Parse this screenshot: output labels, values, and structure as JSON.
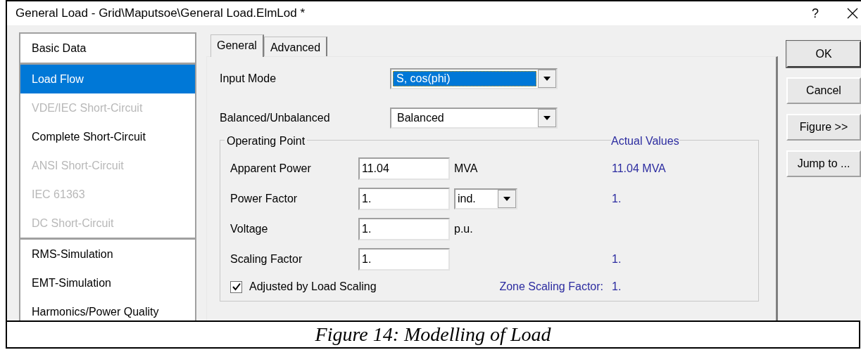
{
  "window": {
    "title": "General Load - Grid\\Maputsoe\\General Load.ElmLod *",
    "help": "?"
  },
  "sidebar": {
    "groups": [
      [
        {
          "label": "Basic Data",
          "selected": false,
          "disabled": false
        }
      ],
      [
        {
          "label": "Load Flow",
          "selected": true,
          "disabled": false
        },
        {
          "label": "VDE/IEC Short-Circuit",
          "selected": false,
          "disabled": true
        },
        {
          "label": "Complete Short-Circuit",
          "selected": false,
          "disabled": false
        },
        {
          "label": "ANSI Short-Circuit",
          "selected": false,
          "disabled": true
        },
        {
          "label": "IEC 61363",
          "selected": false,
          "disabled": true
        },
        {
          "label": "DC Short-Circuit",
          "selected": false,
          "disabled": true
        }
      ],
      [
        {
          "label": "RMS-Simulation",
          "selected": false,
          "disabled": false
        },
        {
          "label": "EMT-Simulation",
          "selected": false,
          "disabled": false
        },
        {
          "label": "Harmonics/Power Quality",
          "selected": false,
          "disabled": false
        }
      ]
    ]
  },
  "tabs": [
    {
      "label": "General",
      "selected": true
    },
    {
      "label": "Advanced",
      "selected": false
    }
  ],
  "selects": [
    {
      "label": "Input Mode",
      "value": "S, cos(phi)",
      "focused": true
    },
    {
      "label": "Balanced/Unbalanced",
      "value": "Balanced",
      "focused": false
    }
  ],
  "operating_point": {
    "title": "Operating Point",
    "actual_title": "Actual Values",
    "rows": [
      {
        "label": "Apparent Power",
        "value": "11.04",
        "unit": "MVA",
        "actual": "11.04 MVA"
      },
      {
        "label": "Power Factor",
        "value": "1.",
        "option": "ind.",
        "actual": "1."
      },
      {
        "label": "Voltage",
        "value": "1.",
        "unit": "p.u."
      },
      {
        "label": "Scaling Factor",
        "value": "1.",
        "actual": "1."
      }
    ],
    "checkbox": {
      "label": "Adjusted by Load Scaling",
      "checked": true
    },
    "zone_label": "Zone Scaling Factor:",
    "zone_value": "1."
  },
  "buttons": [
    {
      "label": "OK",
      "default": true
    },
    {
      "label": "Cancel",
      "default": false
    },
    {
      "label": "Figure >>",
      "default": false
    },
    {
      "label": "Jump to ...",
      "default": false
    }
  ],
  "caption": "Figure 14: Modelling of Load"
}
